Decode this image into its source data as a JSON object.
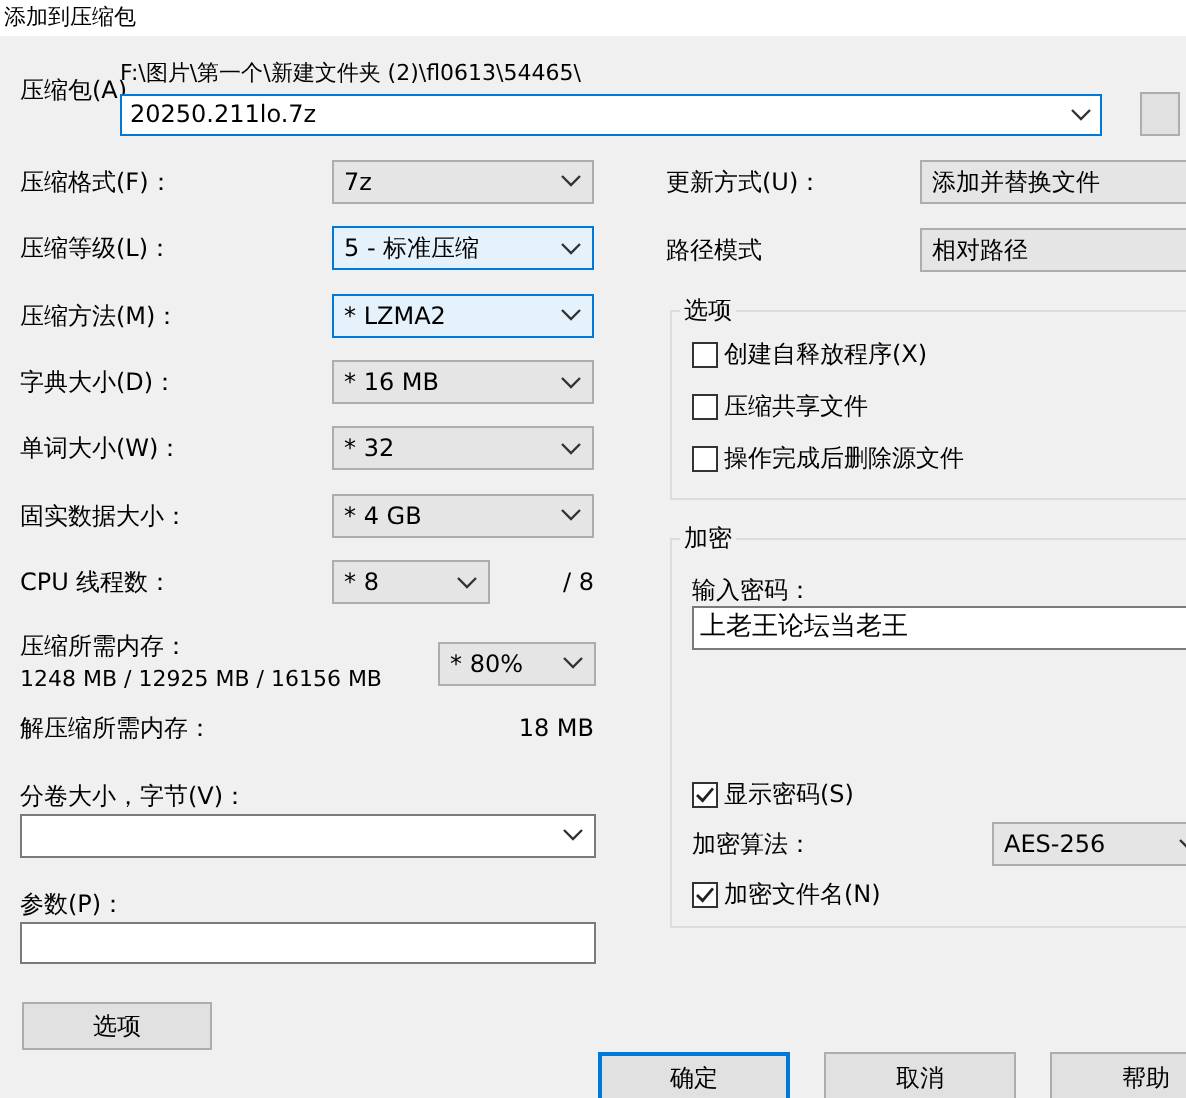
{
  "window": {
    "title": "添加到压缩包"
  },
  "archive": {
    "label": "压缩包(A)",
    "path": "F:\\图片\\第一个\\新建文件夹 (2)\\fl0613\\54465\\",
    "value": "20250.211lo.7z"
  },
  "settings": [
    {
      "label": "压缩格式(F)：",
      "value": "7z",
      "highlighted": false
    },
    {
      "label": "压缩等级(L)：",
      "value": "5 - 标准压缩",
      "highlighted": true
    },
    {
      "label": "压缩方法(M)：",
      "value": "* LZMA2",
      "highlighted": true
    },
    {
      "label": "字典大小(D)：",
      "value": "* 16 MB",
      "highlighted": false
    },
    {
      "label": "单词大小(W)：",
      "value": "* 32",
      "highlighted": false
    },
    {
      "label": "固实数据大小：",
      "value": "* 4 GB",
      "highlighted": false
    }
  ],
  "cpu_threads": {
    "label": "CPU 线程数：",
    "value": "* 8",
    "max": "/ 8"
  },
  "memory": {
    "label": "压缩所需内存：",
    "detail": "1248 MB / 12925 MB / 16156 MB",
    "value": "* 80%"
  },
  "decompress_memory": {
    "label": "解压缩所需内存：",
    "value": "18 MB"
  },
  "volume": {
    "label": "分卷大小，字节(V)："
  },
  "parameters": {
    "label": "参数(P)："
  },
  "options_button": "选项",
  "update_mode": {
    "label": "更新方式(U)：",
    "value": "添加并替换文件"
  },
  "path_mode": {
    "label": "路径模式",
    "value": "相对路径"
  },
  "options_group": {
    "title": "选项",
    "checkboxes": [
      {
        "label": "创建自释放程序(X)",
        "checked": false
      },
      {
        "label": "压缩共享文件",
        "checked": false
      },
      {
        "label": "操作完成后删除源文件",
        "checked": false
      }
    ]
  },
  "encryption": {
    "title": "加密",
    "password_label": "输入密码：",
    "password": "上老王论坛当老王",
    "show_password": {
      "label": "显示密码(S)",
      "checked": true
    },
    "method_label": "加密算法：",
    "method": "AES-256",
    "encrypt_names": {
      "label": "加密文件名(N)",
      "checked": true
    }
  },
  "buttons": [
    {
      "label": "确定",
      "default": true
    },
    {
      "label": "取消",
      "default": false
    },
    {
      "label": "帮助",
      "default": false
    }
  ]
}
